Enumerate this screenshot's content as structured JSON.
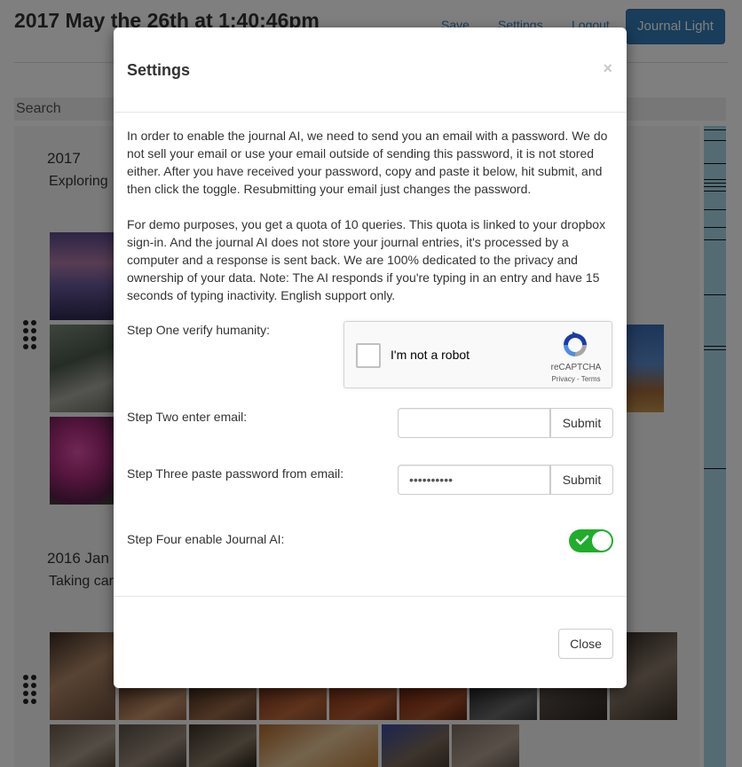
{
  "background": {
    "title": "2017 May the 26th at 1:40:46pm",
    "nav": {
      "save": "Save",
      "settings": "Settings",
      "logout": "Logout"
    },
    "brand_button": "Journal Light",
    "search_placeholder": "Search",
    "entries": [
      {
        "year": "2017",
        "description": "Exploring"
      },
      {
        "year": "2016 Jan",
        "description": "Taking car"
      }
    ]
  },
  "modal": {
    "title": "Settings",
    "close_x": "×",
    "paragraphs": [
      "In order to enable the journal AI, we need to send you an email with a password. We do not sell your email or use your email outside of sending this password, it is not stored either. After you have received your password, copy and paste it below, hit submit, and then click the toggle. Resubmitting your email just changes the password.",
      "For demo purposes, you get a quota of 10 queries. This quota is linked to your dropbox sign-in. And the journal AI does not store your journal entries, it's processed by a computer and a response is sent back. We are 100% dedicated to the privacy and ownership of your data. Note: The AI responds if you're typing in an entry and have 15 seconds of typing inactivity. English support only."
    ],
    "steps": {
      "one": "Step One verify humanity:",
      "two": "Step Two enter email:",
      "three": "Step Three paste password from email:",
      "four": "Step Four enable Journal AI:"
    },
    "recaptcha": {
      "label": "I'm not a robot",
      "brand": "reCAPTCHA",
      "terms": "Privacy - Terms"
    },
    "email": {
      "value": "",
      "submit": "Submit"
    },
    "password": {
      "value": "••••••••••",
      "submit": "Submit"
    },
    "ai_toggle": {
      "enabled": true,
      "color": "#1fad2b"
    },
    "close_button": "Close"
  }
}
